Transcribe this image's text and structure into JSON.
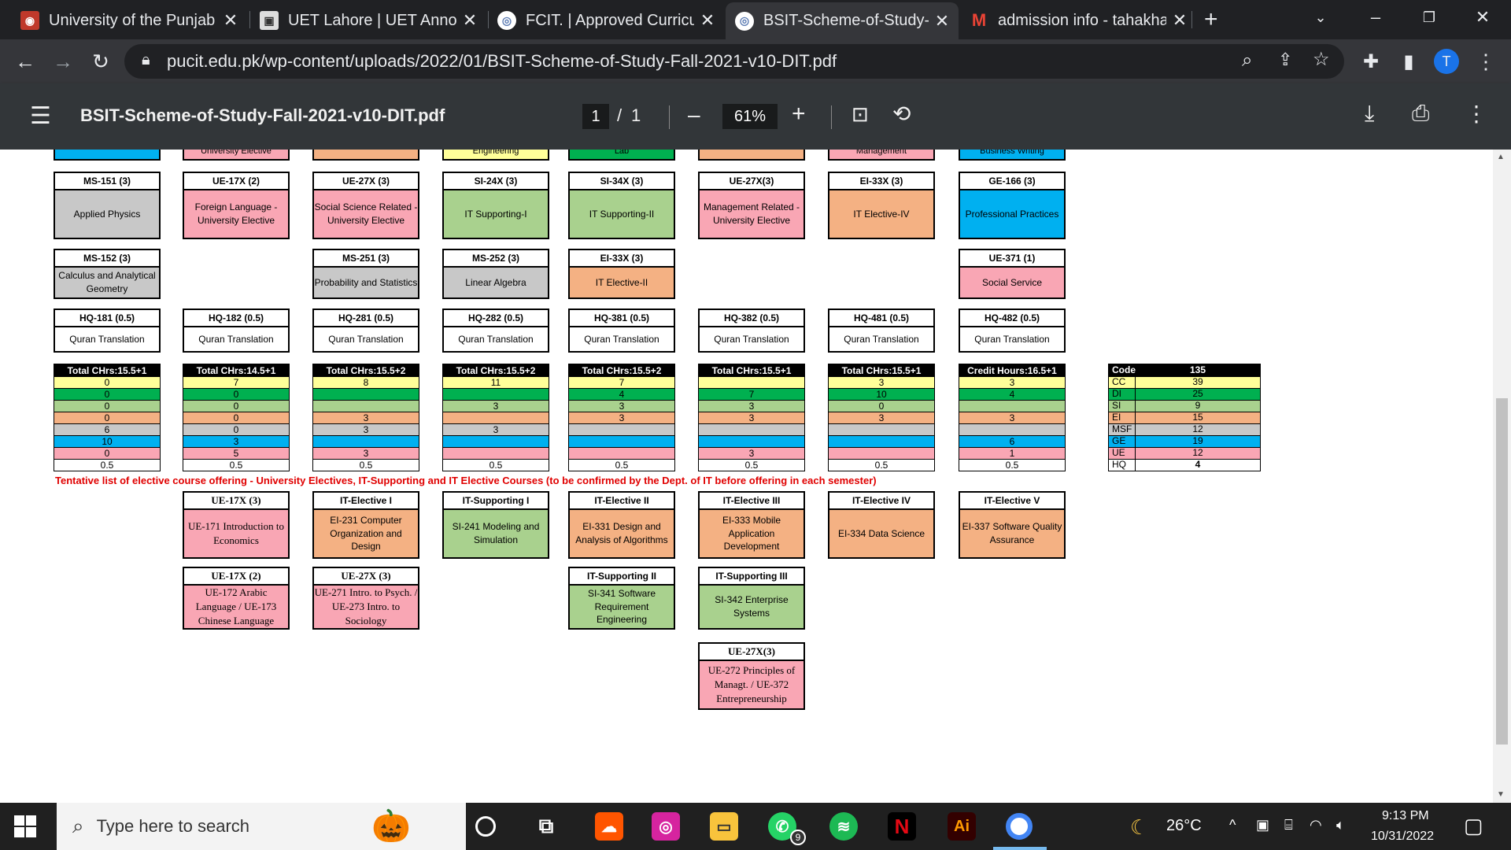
{
  "browser": {
    "tabs": [
      {
        "title": "University of the Punjab -",
        "favicon": "pu-logo-icon",
        "color": "#c0392b"
      },
      {
        "title": "UET Lahore | UET Announ",
        "favicon": "uet-logo-icon",
        "color": "#888888"
      },
      {
        "title": "FCIT. | Approved Curricul",
        "favicon": "fcit-logo-icon",
        "color": "#5b7bb3"
      },
      {
        "title": "BSIT-Scheme-of-Study-Fa",
        "favicon": "pucit-logo-icon",
        "color": "#5b7bb3",
        "active": true
      },
      {
        "title": "admission info - tahakhar",
        "favicon": "gmail-icon",
        "color": "#ea4335"
      }
    ],
    "new_tab": "+",
    "url": "pucit.edu.pk/wp-content/uploads/2022/01/BSIT-Scheme-of-Study-Fall-2021-v10-DIT.pdf",
    "profile_initial": "T"
  },
  "pdf": {
    "title": "BSIT-Scheme-of-Study-Fall-2021-v10-DIT.pdf",
    "page": "1",
    "of": "/",
    "total": "1",
    "zoom": "61%",
    "minus": "–",
    "plus": "+"
  },
  "top_strip": [
    "",
    "University Elective",
    "",
    "Engineering",
    "Lab",
    "",
    "Management",
    "Business Writing"
  ],
  "semester_rows": [
    [
      {
        "code": "MS-151 (3)",
        "name": "Applied Physics",
        "color": "#c8c8c8"
      },
      {
        "code": "UE-17X (2)",
        "name": "Foreign Language - University Elective",
        "color": "#f9a6b4"
      },
      {
        "code": "UE-27X (3)",
        "name": "Social Science Related - University Elective",
        "color": "#f9a6b4"
      },
      {
        "code": "SI-24X (3)",
        "name": "IT Supporting-I",
        "color": "#a9d18e"
      },
      {
        "code": "SI-34X (3)",
        "name": "IT Supporting-II",
        "color": "#a9d18e"
      },
      {
        "code": "UE-27X(3)",
        "name": "Management Related - University Elective",
        "color": "#f9a6b4"
      },
      {
        "code": "EI-33X (3)",
        "name": "IT Elective-IV",
        "color": "#f4b183"
      },
      {
        "code": "GE-166 (3)",
        "name": "Professional Practices",
        "color": "#00b0f0"
      }
    ],
    [
      {
        "code": "MS-152 (3)",
        "name": "Calculus and Analytical Geometry",
        "color": "#c8c8c8"
      },
      null,
      {
        "code": "MS-251 (3)",
        "name": "Probability and Statistics",
        "color": "#c8c8c8"
      },
      {
        "code": "MS-252 (3)",
        "name": "Linear Algebra",
        "color": "#c8c8c8"
      },
      {
        "code": "EI-33X (3)",
        "name": "IT Elective-II",
        "color": "#f4b183"
      },
      null,
      null,
      {
        "code": "UE-371 (1)",
        "name": "Social Service",
        "color": "#f9a6b4"
      }
    ],
    [
      {
        "code": "HQ-181 (0.5)",
        "name": "Quran Translation",
        "color": "#ffffff"
      },
      {
        "code": "HQ-182 (0.5)",
        "name": "Quran Translation",
        "color": "#ffffff"
      },
      {
        "code": "HQ-281 (0.5)",
        "name": "Quran Translation",
        "color": "#ffffff"
      },
      {
        "code": "HQ-282 (0.5)",
        "name": "Quran Translation",
        "color": "#ffffff"
      },
      {
        "code": "HQ-381 (0.5)",
        "name": "Quran Translation",
        "color": "#ffffff"
      },
      {
        "code": "HQ-382 (0.5)",
        "name": "Quran Translation",
        "color": "#ffffff"
      },
      {
        "code": "HQ-481 (0.5)",
        "name": "Quran Translation",
        "color": "#ffffff"
      },
      {
        "code": "HQ-482 (0.5)",
        "name": "Quran Translation",
        "color": "#ffffff"
      }
    ]
  ],
  "row_colors": [
    "#ffff99",
    "#00b050",
    "#a9d18e",
    "#f4b183",
    "#c8c8c8",
    "#00b0f0",
    "#f9a6b4",
    "#ffffff"
  ],
  "totals": [
    {
      "header": "Total CHrs:15.5+1",
      "values": [
        "0",
        "0",
        "0",
        "0",
        "6",
        "10",
        "0",
        "0.5"
      ]
    },
    {
      "header": "Total CHrs:14.5+1",
      "values": [
        "7",
        "0",
        "0",
        "0",
        "0",
        "3",
        "5",
        "0.5"
      ]
    },
    {
      "header": "Total CHrs:15.5+2",
      "values": [
        "8",
        "",
        "",
        "3",
        "3",
        "",
        "3",
        "0.5"
      ]
    },
    {
      "header": "Total CHrs:15.5+2",
      "values": [
        "11",
        "",
        "3",
        "",
        "3",
        "",
        "",
        "0.5"
      ]
    },
    {
      "header": "Total CHrs:15.5+2",
      "values": [
        "7",
        "4",
        "3",
        "3",
        "",
        "",
        "",
        "0.5"
      ]
    },
    {
      "header": "Total CHrs:15.5+1",
      "values": [
        "",
        "7",
        "3",
        "3",
        "",
        "",
        "3",
        "0.5"
      ]
    },
    {
      "header": "Total CHrs:15.5+1",
      "values": [
        "3",
        "10",
        "0",
        "3",
        "",
        "",
        "",
        "0.5"
      ]
    },
    {
      "header": "Credit Hours:16.5+1",
      "values": [
        "3",
        "4",
        "",
        "3",
        "",
        "6",
        "1",
        "0.5"
      ]
    }
  ],
  "code_table": {
    "header": [
      "Code",
      "135"
    ],
    "rows": [
      [
        "CC",
        "39"
      ],
      [
        "DI",
        "25"
      ],
      [
        "SI",
        "9"
      ],
      [
        "EI",
        "15"
      ],
      [
        "MSF",
        "12"
      ],
      [
        "GE",
        "19"
      ],
      [
        "UE",
        "12"
      ],
      [
        "HQ",
        "4"
      ]
    ]
  },
  "tentative_note": "Tentative list of elective course offering - University Electives, IT-Supporting and IT Elective Courses (to be confirmed by the Dept. of IT before offering in each semester)",
  "electives": [
    {
      "col": 1,
      "row": 0,
      "code": "UE-17X (3)",
      "name": "UE-171 Introduction to Economics",
      "color": "#f9a6b4",
      "serif": true
    },
    {
      "col": 2,
      "row": 0,
      "code": "IT-Elective I",
      "name": "EI-231 Computer Organization and Design",
      "color": "#f4b183"
    },
    {
      "col": 3,
      "row": 0,
      "code": "IT-Supporting I",
      "name": "SI-241 Modeling and Simulation",
      "color": "#a9d18e"
    },
    {
      "col": 4,
      "row": 0,
      "code": "IT-Elective II",
      "name": "EI-331 Design and Analysis of Algorithms",
      "color": "#f4b183"
    },
    {
      "col": 5,
      "row": 0,
      "code": "IT-Elective III",
      "name": "EI-333 Mobile Application Development",
      "color": "#f4b183"
    },
    {
      "col": 6,
      "row": 0,
      "code": "IT-Elective IV",
      "name": "EI-334 Data Science",
      "color": "#f4b183"
    },
    {
      "col": 7,
      "row": 0,
      "code": "IT-Elective V",
      "name": "EI-337 Software Quality Assurance",
      "color": "#f4b183"
    },
    {
      "col": 1,
      "row": 1,
      "code": "UE-17X (2)",
      "name": "UE-172 Arabic Language / UE-173 Chinese Language",
      "color": "#f9a6b4",
      "serif": true
    },
    {
      "col": 2,
      "row": 1,
      "code": "UE-27X (3)",
      "name": "UE-271 Intro. to Psych. / UE-273 Intro. to Sociology",
      "color": "#f9a6b4",
      "serif": true
    },
    {
      "col": 4,
      "row": 1,
      "code": "IT-Supporting II",
      "name": "SI-341 Software Requirement Engineering",
      "color": "#a9d18e"
    },
    {
      "col": 5,
      "row": 1,
      "code": "IT-Supporting III",
      "name": "SI-342 Enterprise Systems",
      "color": "#a9d18e"
    },
    {
      "col": 5,
      "row": 2,
      "code": "UE-27X(3)",
      "name": "UE-272 Principles of Managt. / UE-372 Entrepreneurship",
      "color": "#f9a6b4",
      "serif": true
    }
  ],
  "taskbar": {
    "search_placeholder": "Type here to search",
    "weather": "26°C",
    "time": "9:13 PM",
    "date": "10/31/2022",
    "whatsapp_badge": "9",
    "apps": [
      "cortana-icon",
      "task-view-icon",
      "soundcloud-icon",
      "instagram-icon",
      "file-explorer-icon",
      "whatsapp-icon",
      "spotify-icon",
      "netflix-icon",
      "illustrator-icon",
      "chrome-icon"
    ]
  }
}
